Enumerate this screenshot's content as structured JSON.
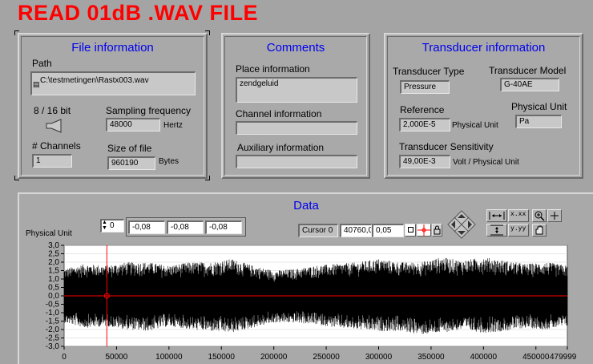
{
  "app_title": "READ 01dB .WAV FILE",
  "file_info": {
    "title": "File information",
    "path_label": "Path",
    "path_value": "C:\\testmetingen\\Rastx003.wav",
    "bits_label": "8 / 16  bit",
    "sampling_label": "Sampling frequency",
    "sampling_value": "48000",
    "sampling_unit": "Hertz",
    "channels_label": "# Channels",
    "channels_value": "1",
    "size_label": "Size of file",
    "size_value": "960190",
    "size_unit": "Bytes"
  },
  "comments": {
    "title": "Comments",
    "place_label": "Place information",
    "place_value": "zendgeluid",
    "channel_label": "Channel information",
    "channel_value": "",
    "aux_label": "Auxiliary information",
    "aux_value": ""
  },
  "transducer": {
    "title": "Transducer information",
    "type_label": "Transducer Type",
    "type_value": "Pressure",
    "model_label": "Transducer Model",
    "model_value": "G-40AE",
    "reference_label": "Reference",
    "reference_value": "2,000E-5",
    "reference_unit": "Physical Unit",
    "phys_unit_label": "Physical Unit",
    "phys_unit_value": "Pa",
    "sensitivity_label": "Transducer Sensitivity",
    "sensitivity_value": "49,00E-3",
    "sensitivity_unit": "Volt / Physical Unit"
  },
  "data_panel": {
    "title": "Data",
    "index_value": "0",
    "array_values": [
      "-0,08",
      "-0,08",
      "-0,08"
    ],
    "cursor_name": "Cursor 0",
    "cursor_x": "40760,0",
    "cursor_y": "0,05",
    "cursor_position": 40760
  },
  "chart_data": {
    "type": "line",
    "title": "",
    "ylabel": "Physical Unit",
    "xlabel": "",
    "xlim": [
      0,
      479999
    ],
    "ylim": [
      -3.0,
      3.0
    ],
    "x_tick_labels": [
      "0",
      "50000",
      "100000",
      "150000",
      "200000",
      "250000",
      "300000",
      "350000",
      "400000",
      "450000",
      "479999"
    ],
    "x_tick_values": [
      0,
      50000,
      100000,
      150000,
      200000,
      250000,
      300000,
      350000,
      400000,
      450000,
      479999
    ],
    "y_tick_labels": [
      "3,0",
      "2,5",
      "2,0",
      "1,5",
      "1,0",
      "0,5",
      "0,0",
      "-0,5",
      "-1,0",
      "-1,5",
      "-2,0",
      "-2,5",
      "-3,0"
    ],
    "y_tick_values": [
      3.0,
      2.5,
      2.0,
      1.5,
      1.0,
      0.5,
      0.0,
      -0.5,
      -1.0,
      -1.5,
      -2.0,
      -2.5,
      -3.0
    ],
    "series": [
      {
        "signal_envelope": {
          "x": [
            0,
            20000,
            40000,
            60000,
            80000,
            100000,
            120000,
            140000,
            160000,
            180000,
            200000,
            220000,
            240000,
            260000,
            280000,
            300000,
            320000,
            340000,
            360000,
            380000,
            400000,
            420000,
            440000,
            460000,
            479999
          ],
          "upper": [
            1.6,
            1.9,
            1.8,
            2.0,
            2.0,
            1.8,
            2.0,
            2.0,
            2.2,
            1.8,
            1.5,
            1.6,
            1.8,
            1.9,
            2.0,
            2.2,
            2.0,
            2.0,
            2.3,
            2.1,
            2.3,
            2.1,
            1.9,
            2.0,
            1.8
          ],
          "lower": [
            -1.6,
            -1.9,
            -1.8,
            -2.0,
            -2.1,
            -1.8,
            -2.0,
            -2.1,
            -2.2,
            -1.9,
            -1.6,
            -1.6,
            -1.7,
            -1.9,
            -2.0,
            -2.1,
            -2.1,
            -2.3,
            -2.2,
            -2.0,
            -2.2,
            -2.1,
            -1.9,
            -2.0,
            -1.8
          ]
        }
      }
    ],
    "colors": {
      "plot_background": "#ffffff",
      "waveform": "#000000",
      "zero_line": "#ff0000",
      "cursor": "#ff0000",
      "grid": "#cfcfcf"
    }
  }
}
